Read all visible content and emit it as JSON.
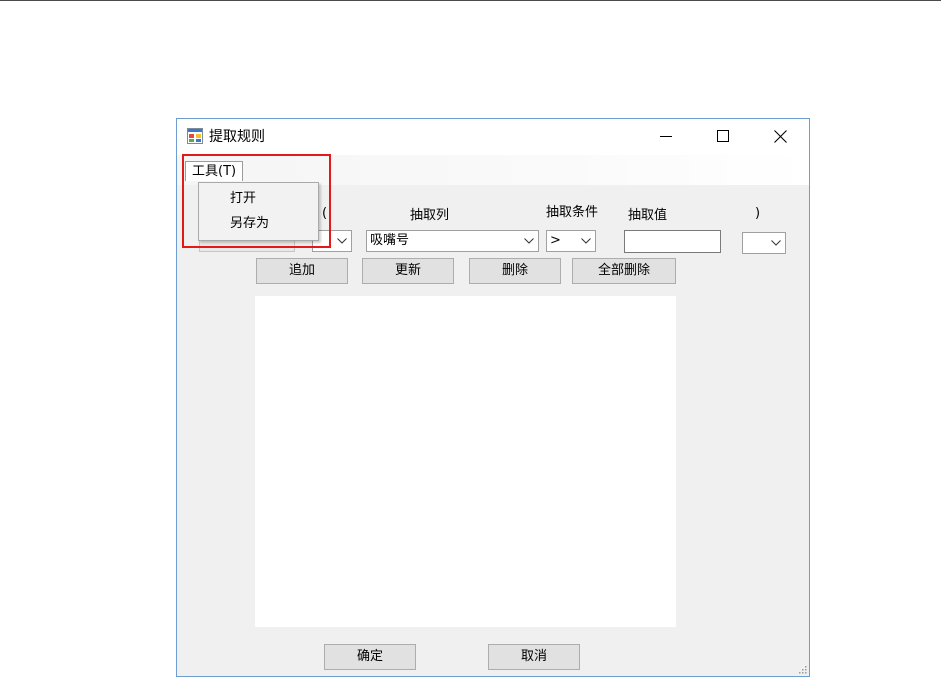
{
  "window": {
    "title": "提取规则",
    "icon": "form-window-icon",
    "controls": {
      "minimize": "minimize-icon",
      "maximize": "maximize-icon",
      "close": "close-icon"
    }
  },
  "menu": {
    "tools_label": "工具(T)",
    "items": [
      {
        "label": "打开"
      },
      {
        "label": "另存为"
      }
    ]
  },
  "rule_row": {
    "headers": {
      "open_paren": "(",
      "column": "抽取列",
      "condition": "抽取条件",
      "value": "抽取值",
      "close_paren": ")"
    },
    "open_paren_value": "",
    "column_value": "吸嘴号",
    "condition_value": ">",
    "value_text": "",
    "close_paren_value": ""
  },
  "actions": {
    "add": "追加",
    "update": "更新",
    "delete": "删除",
    "delete_all": "全部删除"
  },
  "footer": {
    "ok": "确定",
    "cancel": "取消"
  },
  "colors": {
    "window_border": "#6d9dd1",
    "highlight": "#e31a1a",
    "button_face": "#e1e1e1"
  }
}
